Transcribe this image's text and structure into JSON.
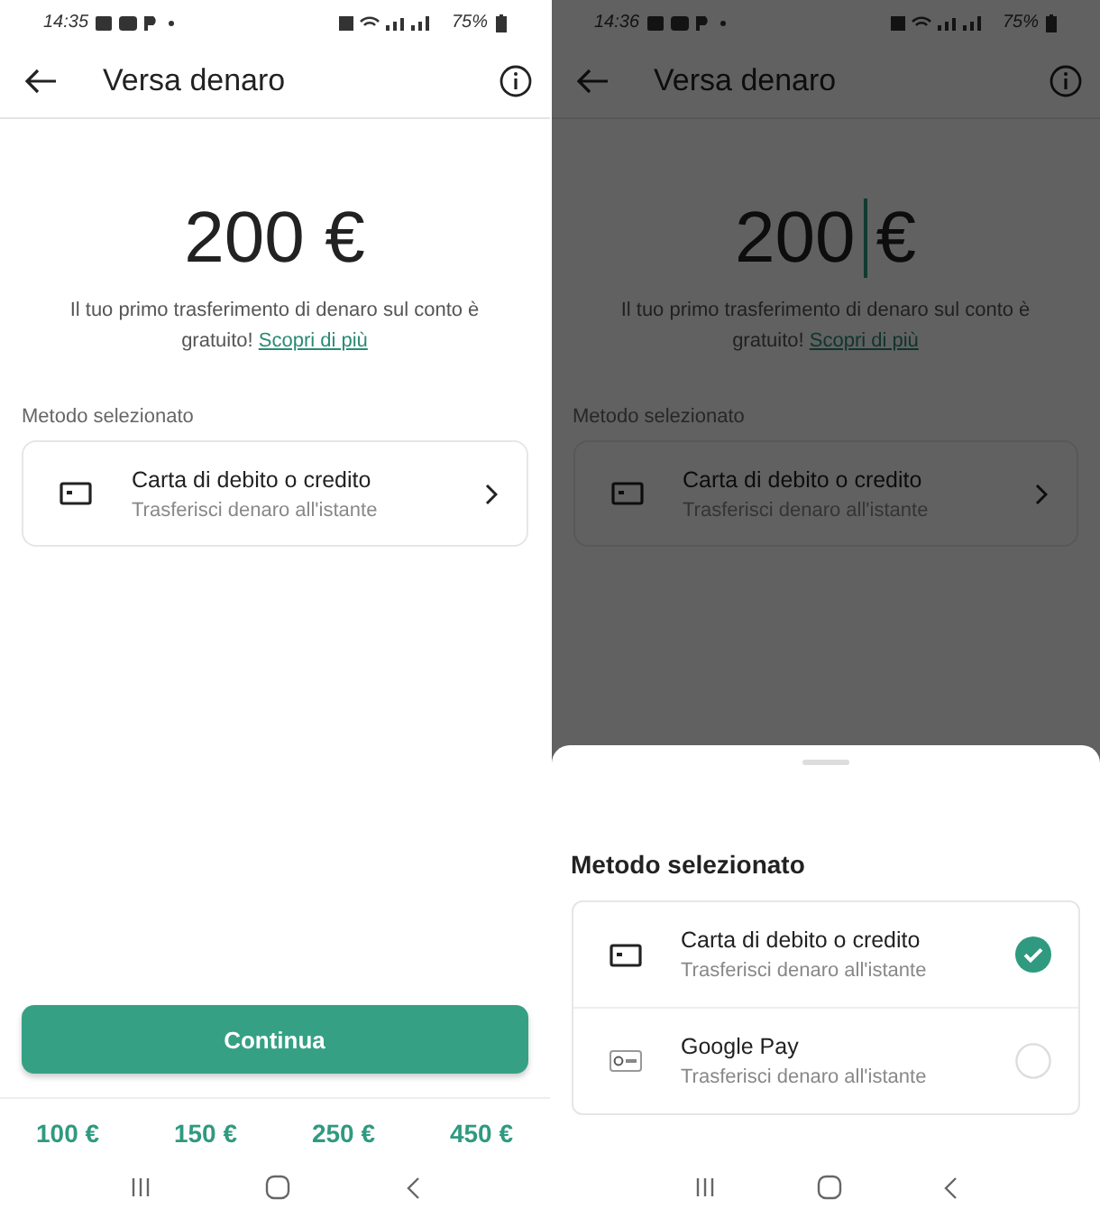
{
  "screens": [
    {
      "dimmed": false,
      "status_bar": {
        "time": "14:35",
        "battery": "75%"
      },
      "header": {
        "title": "Versa denaro"
      },
      "amount": {
        "value": "200",
        "currency": "€",
        "cursor": false
      },
      "note": {
        "text": "Il tuo primo trasferimento di denaro sul conto è gratuito!",
        "link": "Scopri di più"
      },
      "method_label": "Metodo selezionato",
      "method_card": {
        "title": "Carta di debito o credito",
        "subtitle": "Trasferisci denaro all'istante"
      },
      "continue_button": "Continua",
      "quick_amounts": [
        "100 €",
        "150 €",
        "250 €",
        "450 €"
      ]
    },
    {
      "dimmed": true,
      "status_bar": {
        "time": "14:36",
        "battery": "75%"
      },
      "header": {
        "title": "Versa denaro"
      },
      "amount": {
        "value": "200",
        "currency": "€",
        "cursor": true
      },
      "note": {
        "text": "Il tuo primo trasferimento di denaro sul conto è gratuito!",
        "link": "Scopri di più"
      },
      "method_label": "Metodo selezionato",
      "method_card": {
        "title": "Carta di debito o credito",
        "subtitle": "Trasferisci denaro all'istante"
      },
      "sheet": {
        "title": "Metodo selezionato",
        "options": [
          {
            "kind": "card",
            "title": "Carta di debito o credito",
            "subtitle": "Trasferisci denaro all'istante",
            "selected": true
          },
          {
            "kind": "gpay",
            "title": "Google Pay",
            "subtitle": "Trasferisci denaro all'istante",
            "selected": false
          }
        ]
      }
    }
  ]
}
